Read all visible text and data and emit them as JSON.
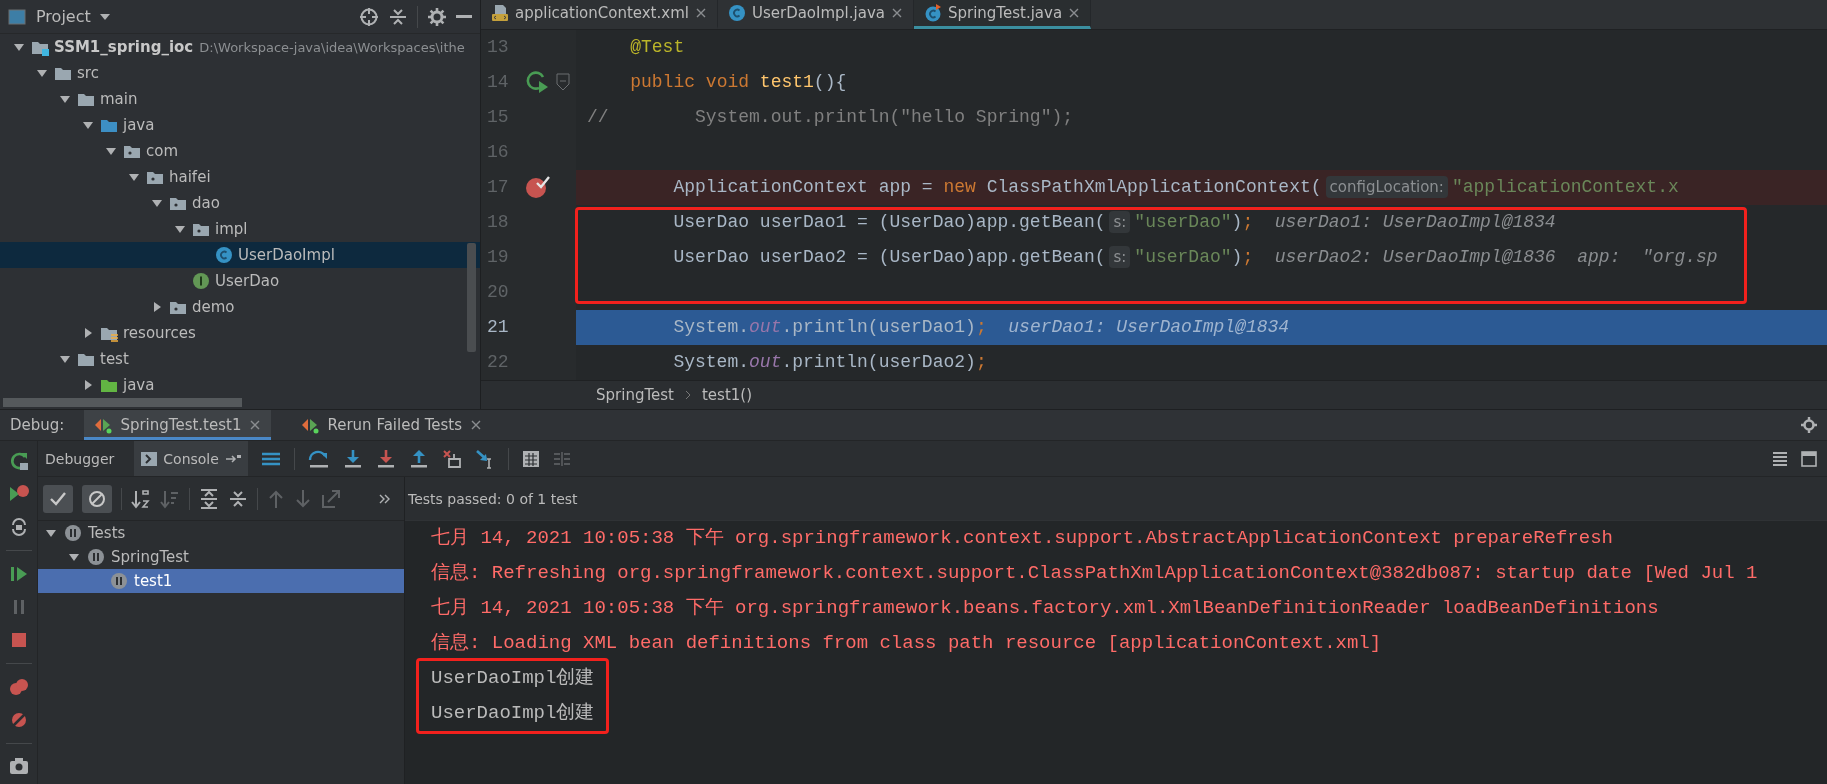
{
  "project": {
    "title": "Project",
    "tree": [
      {
        "label": "SSM1_spring_ioc",
        "path": "D:\\Workspace-java\\idea\\Workspaces\\ithe",
        "kind": "module",
        "expanded": true,
        "selected": false,
        "children": [
          {
            "label": "src",
            "kind": "folder",
            "expanded": true,
            "selected": false,
            "children": [
              {
                "label": "main",
                "kind": "folder",
                "expanded": true,
                "selected": false,
                "children": [
                  {
                    "label": "java",
                    "kind": "source",
                    "expanded": true,
                    "selected": false,
                    "children": [
                      {
                        "label": "com",
                        "kind": "package",
                        "expanded": true,
                        "selected": false,
                        "children": [
                          {
                            "label": "haifei",
                            "kind": "package",
                            "expanded": true,
                            "selected": false,
                            "children": [
                              {
                                "label": "dao",
                                "kind": "package",
                                "expanded": true,
                                "selected": false,
                                "children": [
                                  {
                                    "label": "impl",
                                    "kind": "package",
                                    "expanded": true,
                                    "selected": false,
                                    "children": [
                                      {
                                        "label": "UserDaoImpl",
                                        "kind": "class",
                                        "selected": true
                                      }
                                    ]
                                  },
                                  {
                                    "label": "UserDao",
                                    "kind": "interface",
                                    "selected": false
                                  }
                                ]
                              },
                              {
                                "label": "demo",
                                "kind": "package",
                                "expanded": false,
                                "selected": false
                              }
                            ]
                          }
                        ]
                      }
                    ]
                  },
                  {
                    "label": "resources",
                    "kind": "resources",
                    "expanded": false,
                    "selected": false
                  }
                ]
              },
              {
                "label": "test",
                "kind": "folder",
                "expanded": true,
                "selected": false,
                "children": [
                  {
                    "label": "java",
                    "kind": "test_source",
                    "expanded": false,
                    "selected": false
                  }
                ]
              }
            ]
          }
        ]
      }
    ]
  },
  "editor": {
    "tabs": [
      {
        "label": "applicationContext.xml",
        "kind": "xml",
        "selected": false
      },
      {
        "label": "UserDaoImpl.java",
        "kind": "class",
        "selected": false
      },
      {
        "label": "SpringTest.java",
        "kind": "test",
        "selected": true
      }
    ],
    "lines": [
      {
        "number": "13",
        "tokens": [
          {
            "kind": "annotation",
            "text": "    @Test"
          }
        ]
      },
      {
        "number": "14",
        "runnable": true,
        "fold": true,
        "tokens": [
          {
            "kind": "keyword",
            "text": "    public"
          },
          {
            "kind": "keyword",
            "text": " void"
          },
          {
            "kind": "method",
            "text": " test1"
          },
          {
            "kind": "plain",
            "text": "(){"
          }
        ]
      },
      {
        "number": "15",
        "tokens": [
          {
            "kind": "comment",
            "text": "//        System.out.println(\"hello Spring\");"
          }
        ]
      },
      {
        "number": "16"
      },
      {
        "number": "17",
        "breakpoint": true,
        "tokens": [
          {
            "kind": "plain",
            "text": "        ApplicationContext app = "
          },
          {
            "kind": "keyword",
            "text": "new"
          },
          {
            "kind": "plain",
            "text": " ClassPathXmlApplicationContext("
          },
          {
            "kind": "hint",
            "text": "configLocation:"
          },
          {
            "kind": "string",
            "text": "\"applicationContext.x"
          }
        ]
      },
      {
        "number": "18",
        "framed": true,
        "tokens": [
          {
            "kind": "plain",
            "text": "        UserDao userDao1 = (UserDao)app.getBean("
          },
          {
            "kind": "hint",
            "text": "s:"
          },
          {
            "kind": "string",
            "text": "\"userDao\""
          },
          {
            "kind": "plain",
            "text": ")"
          },
          {
            "kind": "semicolon",
            "text": ";"
          },
          {
            "kind": "value",
            "text": "userDao1: UserDaoImpl@1834"
          }
        ]
      },
      {
        "number": "19",
        "framed": true,
        "tokens": [
          {
            "kind": "plain",
            "text": "        UserDao userDao2 = (UserDao)app.getBean("
          },
          {
            "kind": "hint",
            "text": "s:"
          },
          {
            "kind": "string",
            "text": "\"userDao\""
          },
          {
            "kind": "plain",
            "text": ")"
          },
          {
            "kind": "semicolon",
            "text": ";"
          },
          {
            "kind": "value",
            "text": "userDao2: UserDaoImpl@1836"
          },
          {
            "kind": "value",
            "text": "app:"
          },
          {
            "kind": "value",
            "text": "\"org.sp"
          }
        ]
      },
      {
        "number": "20",
        "framed": true
      },
      {
        "number": "21",
        "current": true,
        "tokens": [
          {
            "kind": "plain",
            "text": "        System."
          },
          {
            "kind": "static",
            "text": "out"
          },
          {
            "kind": "plain",
            "text": ".println(userDao1)"
          },
          {
            "kind": "semicolon",
            "text": ";"
          },
          {
            "kind": "value",
            "text": "userDao1: UserDaoImpl@1834"
          }
        ]
      },
      {
        "number": "22",
        "tokens": [
          {
            "kind": "plain",
            "text": "        System."
          },
          {
            "kind": "static",
            "text": "out"
          },
          {
            "kind": "plain",
            "text": ".println(userDao2)"
          },
          {
            "kind": "semicolon",
            "text": ";"
          }
        ]
      }
    ],
    "breadcrumbs": [
      "SpringTest",
      "test1()"
    ]
  },
  "debug": {
    "title": "Debug:",
    "tabs": [
      {
        "label": "SpringTest.test1",
        "selected": true
      },
      {
        "label": "Rerun Failed Tests",
        "selected": false
      }
    ],
    "subtabs": [
      {
        "label": "Debugger",
        "selected": false
      },
      {
        "label": "Console",
        "selected": true
      }
    ],
    "filters": [
      {
        "kind": "passed",
        "on": true
      },
      {
        "kind": "ignored",
        "on": true
      }
    ],
    "tests": [
      {
        "label": "Tests",
        "expanded": true,
        "selected": false,
        "children": [
          {
            "label": "SpringTest",
            "expanded": true,
            "selected": false,
            "children": [
              {
                "label": "test1",
                "selected": true
              }
            ]
          }
        ]
      }
    ],
    "status": "Tests passed: 0 of 1 test",
    "console": [
      {
        "kind": "log",
        "text": "七月 14, 2021 10:05:38 下午 org.springframework.context.support.AbstractApplicationContext prepareRefresh"
      },
      {
        "kind": "log",
        "text": "信息: Refreshing org.springframework.context.support.ClassPathXmlApplicationContext@382db087: startup date [Wed Jul 1"
      },
      {
        "kind": "log",
        "text": "七月 14, 2021 10:05:38 下午 org.springframework.beans.factory.xml.XmlBeanDefinitionReader loadBeanDefinitions"
      },
      {
        "kind": "log",
        "text": "信息: Loading XML bean definitions from class path resource [applicationContext.xml]"
      },
      {
        "kind": "out",
        "text": "UserDaoImpl创建",
        "framed": true
      },
      {
        "kind": "out",
        "text": "UserDaoImpl创建",
        "framed": true
      }
    ]
  }
}
